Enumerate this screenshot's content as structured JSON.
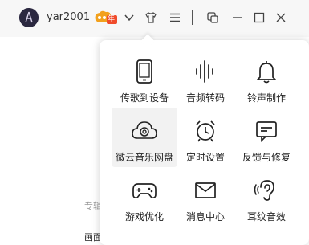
{
  "header": {
    "username": "yar2001",
    "vip_badge": "年"
  },
  "background": {
    "text1": "专辑",
    "text2": "画面"
  },
  "menu": {
    "items": [
      {
        "label": "传歌到设备",
        "icon": "phone-icon"
      },
      {
        "label": "音频转码",
        "icon": "soundwave-icon"
      },
      {
        "label": "铃声制作",
        "icon": "bell-icon"
      },
      {
        "label": "微云音乐网盘",
        "icon": "cloud-icon"
      },
      {
        "label": "定时设置",
        "icon": "alarm-clock-icon"
      },
      {
        "label": "反馈与修复",
        "icon": "feedback-icon"
      },
      {
        "label": "游戏优化",
        "icon": "gamepad-icon"
      },
      {
        "label": "消息中心",
        "icon": "mail-icon"
      },
      {
        "label": "耳纹音效",
        "icon": "ear-icon"
      }
    ]
  }
}
